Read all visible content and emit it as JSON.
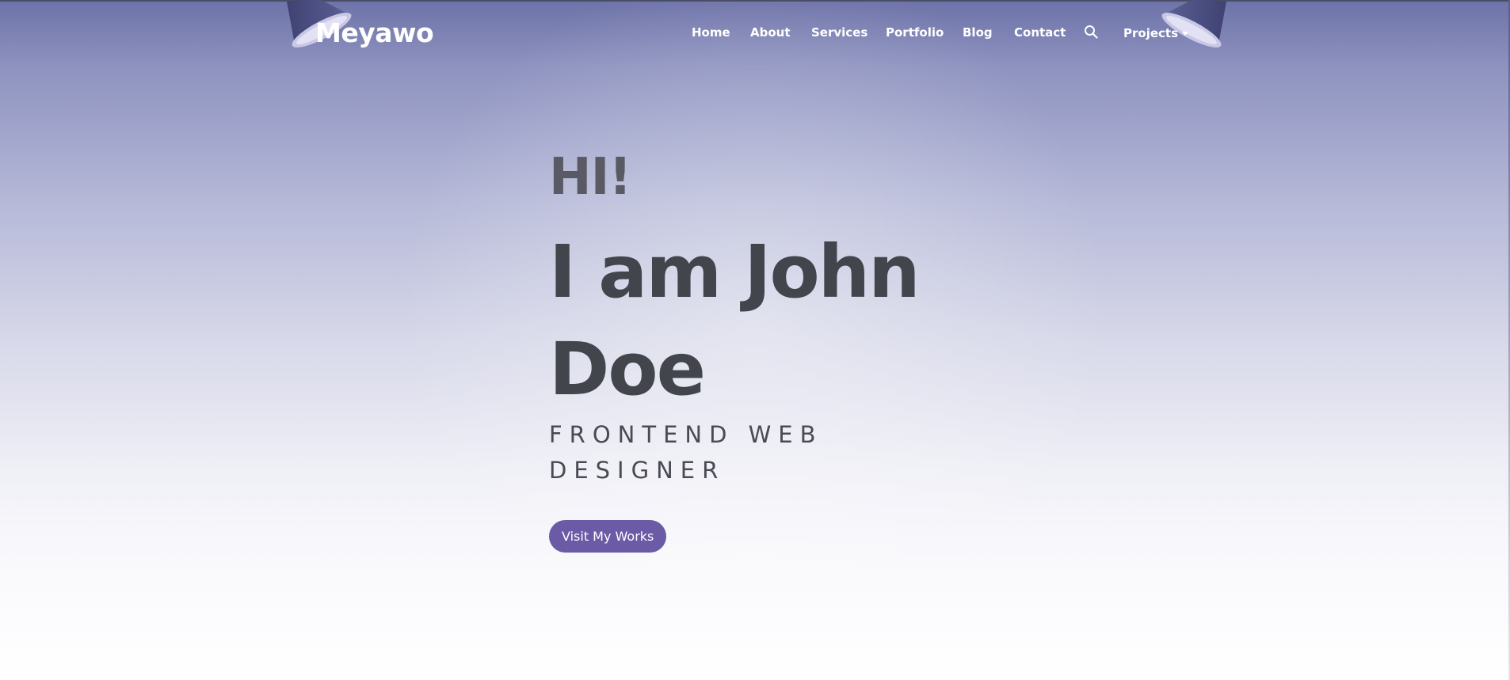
{
  "brand": {
    "name": "Meyawo"
  },
  "nav": {
    "items": [
      {
        "label": "Home"
      },
      {
        "label": "About"
      },
      {
        "label": "Services"
      },
      {
        "label": "Portfolio"
      },
      {
        "label": "Blog"
      },
      {
        "label": "Contact"
      }
    ],
    "search_icon": "search-icon",
    "projects_label": "Projects",
    "projects_icon": "caret-down-icon"
  },
  "hero": {
    "greeting": "HI!",
    "name": "I am John Doe",
    "role": "Frontend Web Designer",
    "cta_label": "Visit My Works"
  },
  "colors": {
    "accent": "#6b5aa6",
    "heading": "#42454c",
    "nav_text": "#ffffff",
    "header_bg": "#6d72a8"
  }
}
